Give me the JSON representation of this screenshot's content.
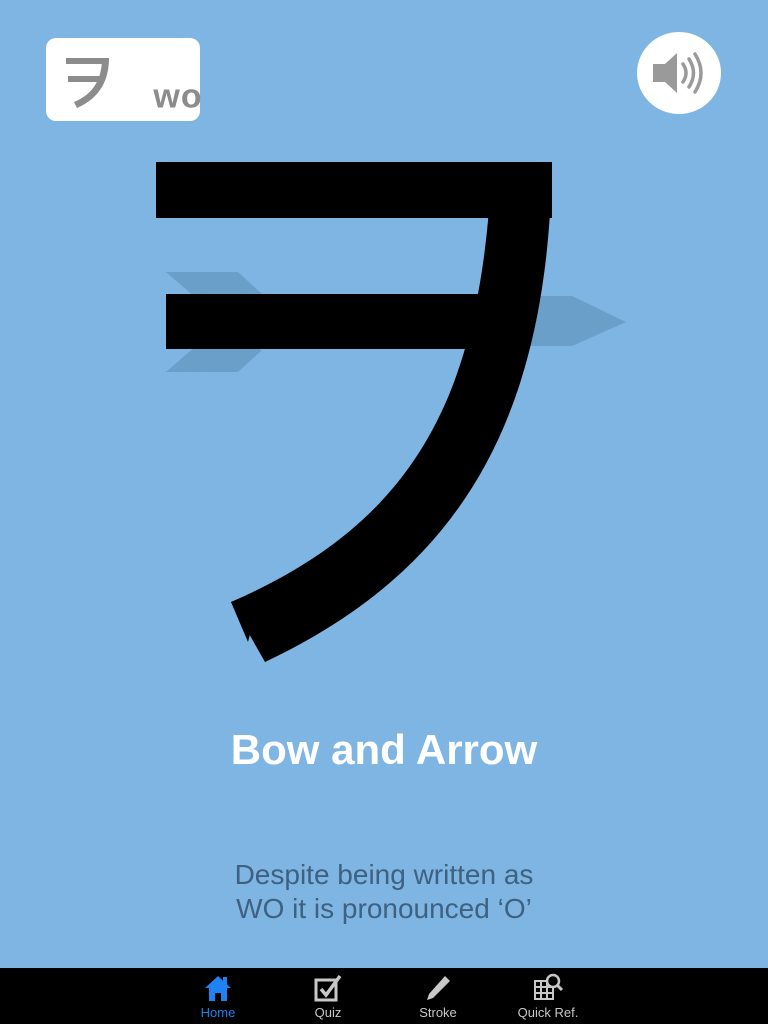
{
  "badge": {
    "kana": "ヲ",
    "romaji": "wo"
  },
  "sound_button": {
    "icon": "speaker-icon"
  },
  "card": {
    "title": "Bow and Arrow",
    "description_lines": [
      "Despite being written as",
      "WO it is pronounced ‘O’"
    ]
  },
  "tabs": [
    {
      "label": "Home",
      "icon": "home-icon",
      "active": true
    },
    {
      "label": "Quiz",
      "icon": "checkbox-icon",
      "active": false
    },
    {
      "label": "Stroke",
      "icon": "pencil-icon",
      "active": false
    },
    {
      "label": "Quick Ref.",
      "icon": "grid-search-icon",
      "active": false
    }
  ],
  "colors": {
    "background": "#7fb5e3",
    "arrow": "#6a9fc9",
    "title": "#ffffff",
    "description": "#3e6181",
    "tab_active": "#1e82f0",
    "tab_inactive": "#c8c8c8"
  }
}
